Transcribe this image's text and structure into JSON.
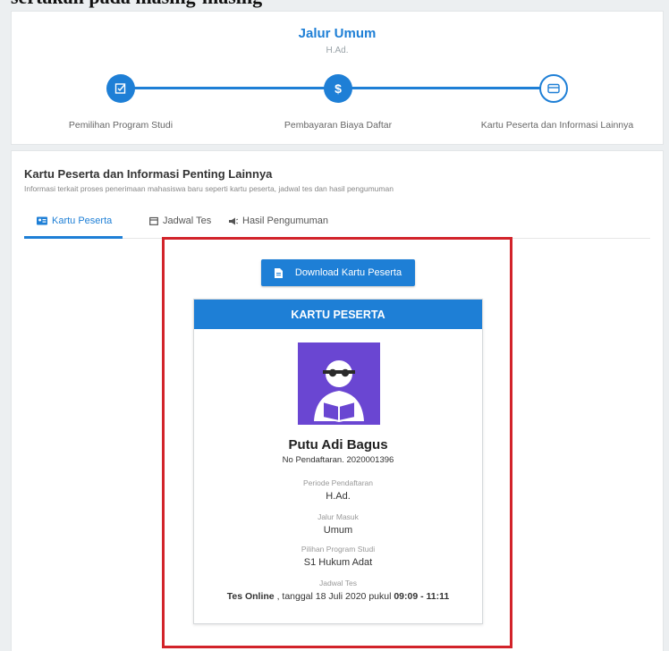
{
  "caption": "sertakan pada masing-masing",
  "header": {
    "title": "Jalur Umum",
    "subtitle": "H.Ad."
  },
  "steps": [
    {
      "label": "Pemilihan Program Studi",
      "icon": "edit-icon",
      "state": "active"
    },
    {
      "label": "Pembayaran Biaya Daftar",
      "icon": "dollar-icon",
      "state": "active"
    },
    {
      "label": "Kartu Peserta dan Informasi Lainnya",
      "icon": "card-icon",
      "state": "current"
    }
  ],
  "section": {
    "title": "Kartu Peserta dan Informasi Penting Lainnya",
    "subtitle": "Informasi terkait proses penerimaan mahasiswa baru seperti kartu peserta, jadwal tes dan hasil pengumuman"
  },
  "tabs": [
    {
      "label": "Kartu Peserta",
      "icon": "id-card-icon",
      "active": true
    },
    {
      "label": "Jadwal Tes",
      "icon": "calendar-icon",
      "active": false
    },
    {
      "label": "Hasil Pengumuman",
      "icon": "megaphone-icon",
      "active": false
    }
  ],
  "download_label": "Download Kartu Peserta",
  "card": {
    "header": "KARTU PESERTA",
    "name": "Putu Adi Bagus",
    "registration": "No Pendaftaran. 2020001396",
    "period_label": "Periode Pendaftaran",
    "period_value": "H.Ad.",
    "route_label": "Jalur Masuk",
    "route_value": "Umum",
    "program_label": "Pilihan Program Studi",
    "program_value": "S1 Hukum Adat",
    "schedule_label": "Jadwal Tes",
    "schedule_mode": "Tes Online",
    "schedule_mid": " , tanggal 18 Juli 2020 pukul ",
    "schedule_time": "09:09 - 11:11"
  },
  "colors": {
    "accent": "#1e7fd6",
    "highlight_box": "#d2232a",
    "avatar_bg": "#6a46d2"
  }
}
